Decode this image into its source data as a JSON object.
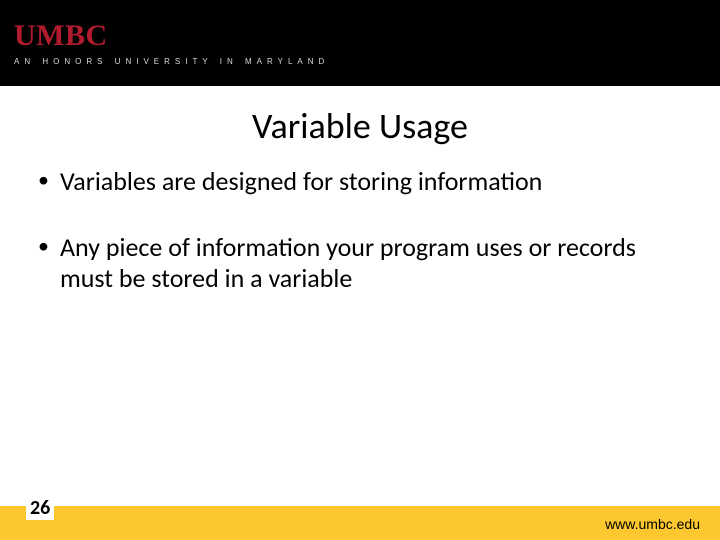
{
  "header": {
    "logo_text": "UMBC",
    "tagline": "AN HONORS UNIVERSITY IN MARYLAND"
  },
  "slide": {
    "title": "Variable Usage",
    "bullets": [
      "Variables are designed for storing information",
      "Any piece of information your program uses or records must be stored in a variable"
    ]
  },
  "footer": {
    "page_number": "26",
    "url": "www.umbc.edu"
  }
}
